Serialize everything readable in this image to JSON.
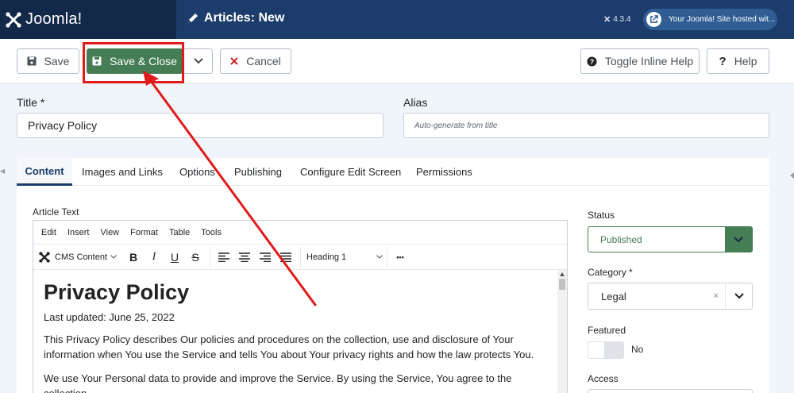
{
  "header": {
    "logo_text": "Joomla!",
    "page_title": "Articles: New",
    "version": "4.3.4",
    "hosted_text": "Your Joomla! Site hosted wit..."
  },
  "toolbar": {
    "save_label": "Save",
    "save_close_label": "Save & Close",
    "cancel_label": "Cancel",
    "inline_help_label": "Toggle Inline Help",
    "help_label": "Help"
  },
  "form": {
    "title_label": "Title *",
    "title_value": "Privacy Policy",
    "alias_label": "Alias",
    "alias_placeholder": "Auto-generate from title"
  },
  "tabs": [
    "Content",
    "Images and Links",
    "Options",
    "Publishing",
    "Configure Edit Screen",
    "Permissions"
  ],
  "editor": {
    "label": "Article Text",
    "menu": [
      "Edit",
      "Insert",
      "View",
      "Format",
      "Table",
      "Tools"
    ],
    "cms_content": "CMS Content",
    "block_format": "Heading 1",
    "more": "•••",
    "doc_title": "Privacy Policy",
    "doc_updated": "Last updated: June 25, 2022",
    "doc_para1": "This Privacy Policy describes Our policies and procedures on the collection, use and disclosure of Your information when You use the Service and tells You about Your privacy rights and how the law protects You.",
    "doc_para2": "We use Your Personal data to provide and improve the Service. By using the Service, You agree to the collection"
  },
  "sidebar": {
    "status_label": "Status",
    "status_value": "Published",
    "category_label": "Category *",
    "category_value": "Legal",
    "category_clear": "×",
    "featured_label": "Featured",
    "featured_value": "No",
    "access_label": "Access"
  },
  "colors": {
    "header_bg": "#1c3d6b",
    "logo_bg": "#13294a",
    "success": "#457d54",
    "annotation": "#e11b1b"
  },
  "icons": {
    "logo": "joomla-logo-icon",
    "pencil": "pencil-icon",
    "save": "floppy-disk-icon",
    "cancel": "x-icon",
    "help_circle": "question-circle-icon",
    "help": "question-icon",
    "external": "external-link-icon",
    "caret": "chevron-down-icon"
  }
}
